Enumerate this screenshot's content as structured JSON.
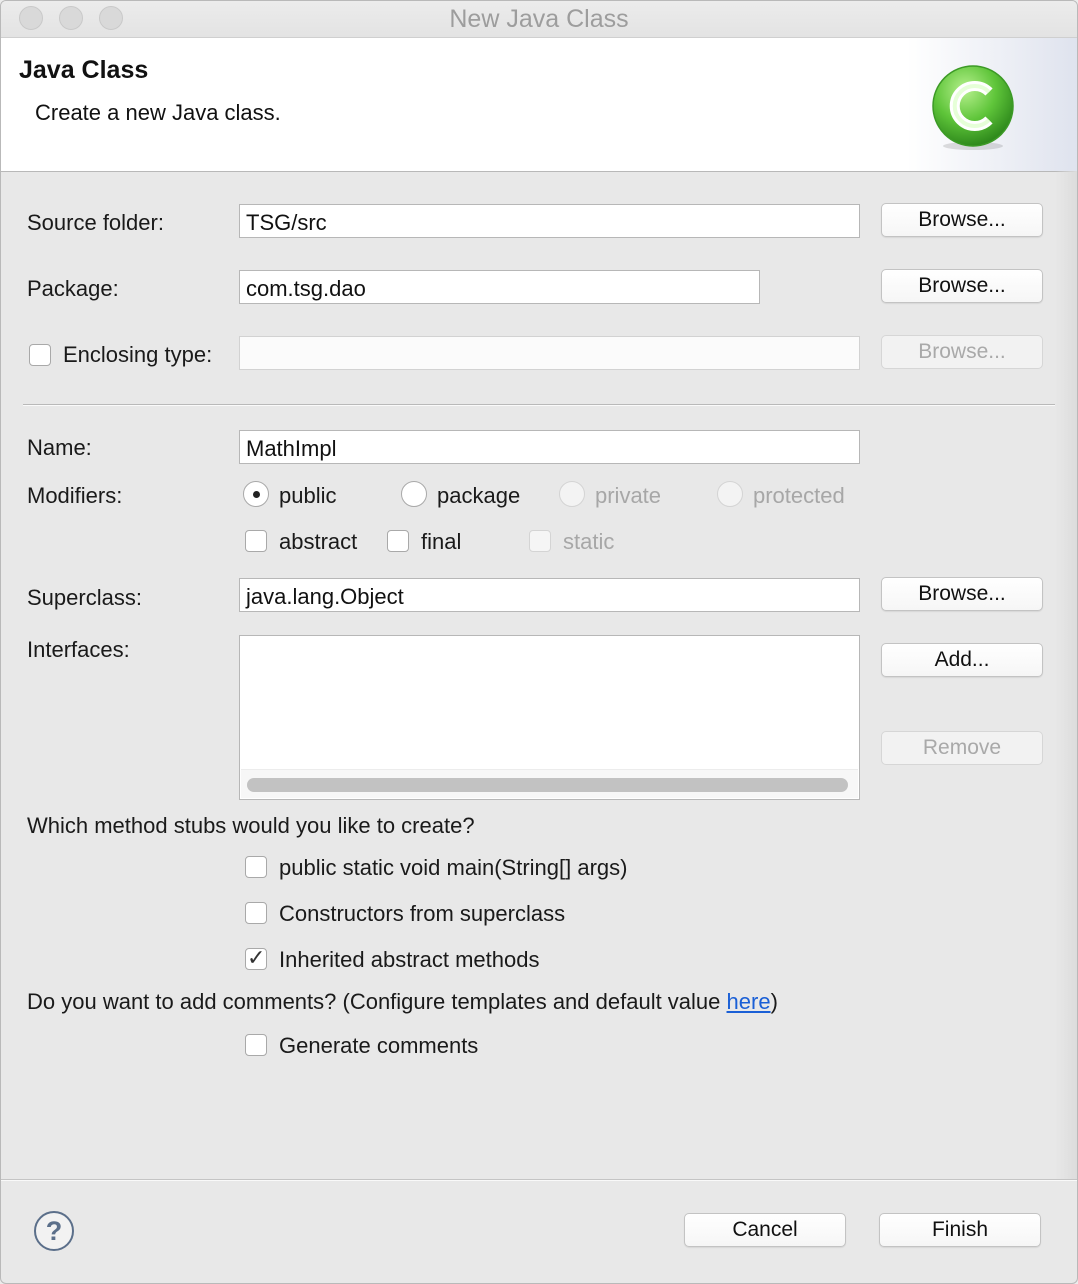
{
  "window": {
    "title": "New Java Class"
  },
  "header": {
    "title": "Java Class",
    "description": "Create a new Java class.",
    "icon": "java-class-c-icon"
  },
  "form": {
    "source_folder": {
      "label": "Source folder:",
      "value": "TSG/src",
      "browse_label": "Browse..."
    },
    "package": {
      "label": "Package:",
      "value": "com.tsg.dao",
      "browse_label": "Browse..."
    },
    "enclosing_type": {
      "label": "Enclosing type:",
      "value": "",
      "checked": false,
      "browse_label": "Browse..."
    },
    "name": {
      "label": "Name:",
      "value": "MathImpl"
    },
    "modifiers": {
      "label": "Modifiers:",
      "radios": [
        {
          "label": "public",
          "selected": true,
          "enabled": true
        },
        {
          "label": "package",
          "selected": false,
          "enabled": true
        },
        {
          "label": "private",
          "selected": false,
          "enabled": false
        },
        {
          "label": "protected",
          "selected": false,
          "enabled": false
        }
      ],
      "checks": [
        {
          "label": "abstract",
          "checked": false,
          "enabled": true
        },
        {
          "label": "final",
          "checked": false,
          "enabled": true
        },
        {
          "label": "static",
          "checked": false,
          "enabled": false
        }
      ]
    },
    "superclass": {
      "label": "Superclass:",
      "value": "java.lang.Object",
      "browse_label": "Browse..."
    },
    "interfaces": {
      "label": "Interfaces:",
      "add_label": "Add...",
      "remove_label": "Remove",
      "items": []
    },
    "method_stubs": {
      "question": "Which method stubs would you like to create?",
      "options": [
        {
          "label": "public static void main(String[] args)",
          "checked": false
        },
        {
          "label": "Constructors from superclass",
          "checked": false
        },
        {
          "label": "Inherited abstract methods",
          "checked": true
        }
      ]
    },
    "comments": {
      "question_prefix": "Do you want to add comments? (Configure templates and default value ",
      "link": "here",
      "question_suffix": ")",
      "option": {
        "label": "Generate comments",
        "checked": false
      }
    }
  },
  "footer": {
    "help": "?",
    "cancel_label": "Cancel",
    "finish_label": "Finish"
  },
  "colors": {
    "link": "#1a5fd6",
    "icon_green": "#5fc53a"
  }
}
